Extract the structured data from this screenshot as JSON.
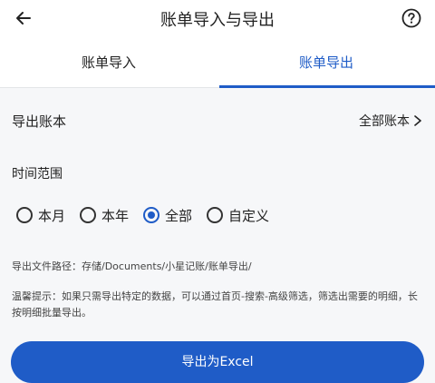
{
  "header": {
    "title": "账单导入与导出",
    "back_icon": "arrow-left-icon",
    "help_icon": "question-circle-icon"
  },
  "tabs": [
    {
      "label": "账单导入",
      "active": false
    },
    {
      "label": "账单导出",
      "active": true
    }
  ],
  "export_book": {
    "label": "导出账本",
    "value": "全部账本",
    "chevron_icon": "chevron-right-icon"
  },
  "time_range": {
    "label": "时间范围",
    "options": [
      {
        "label": "本月",
        "selected": false
      },
      {
        "label": "本年",
        "selected": false
      },
      {
        "label": "全部",
        "selected": true
      },
      {
        "label": "自定义",
        "selected": false
      }
    ]
  },
  "export_path": "导出文件路径：存储/Documents/小星记账/账单导出/",
  "tip": "温馨提示：如果只需导出特定的数据，可以通过首页-搜索-高级筛选，筛选出需要的明细，长按明细批量导出。",
  "export_button": "导出为Excel",
  "colors": {
    "accent": "#1f5cc7",
    "background": "#f6f7f9",
    "surface": "#ffffff"
  }
}
